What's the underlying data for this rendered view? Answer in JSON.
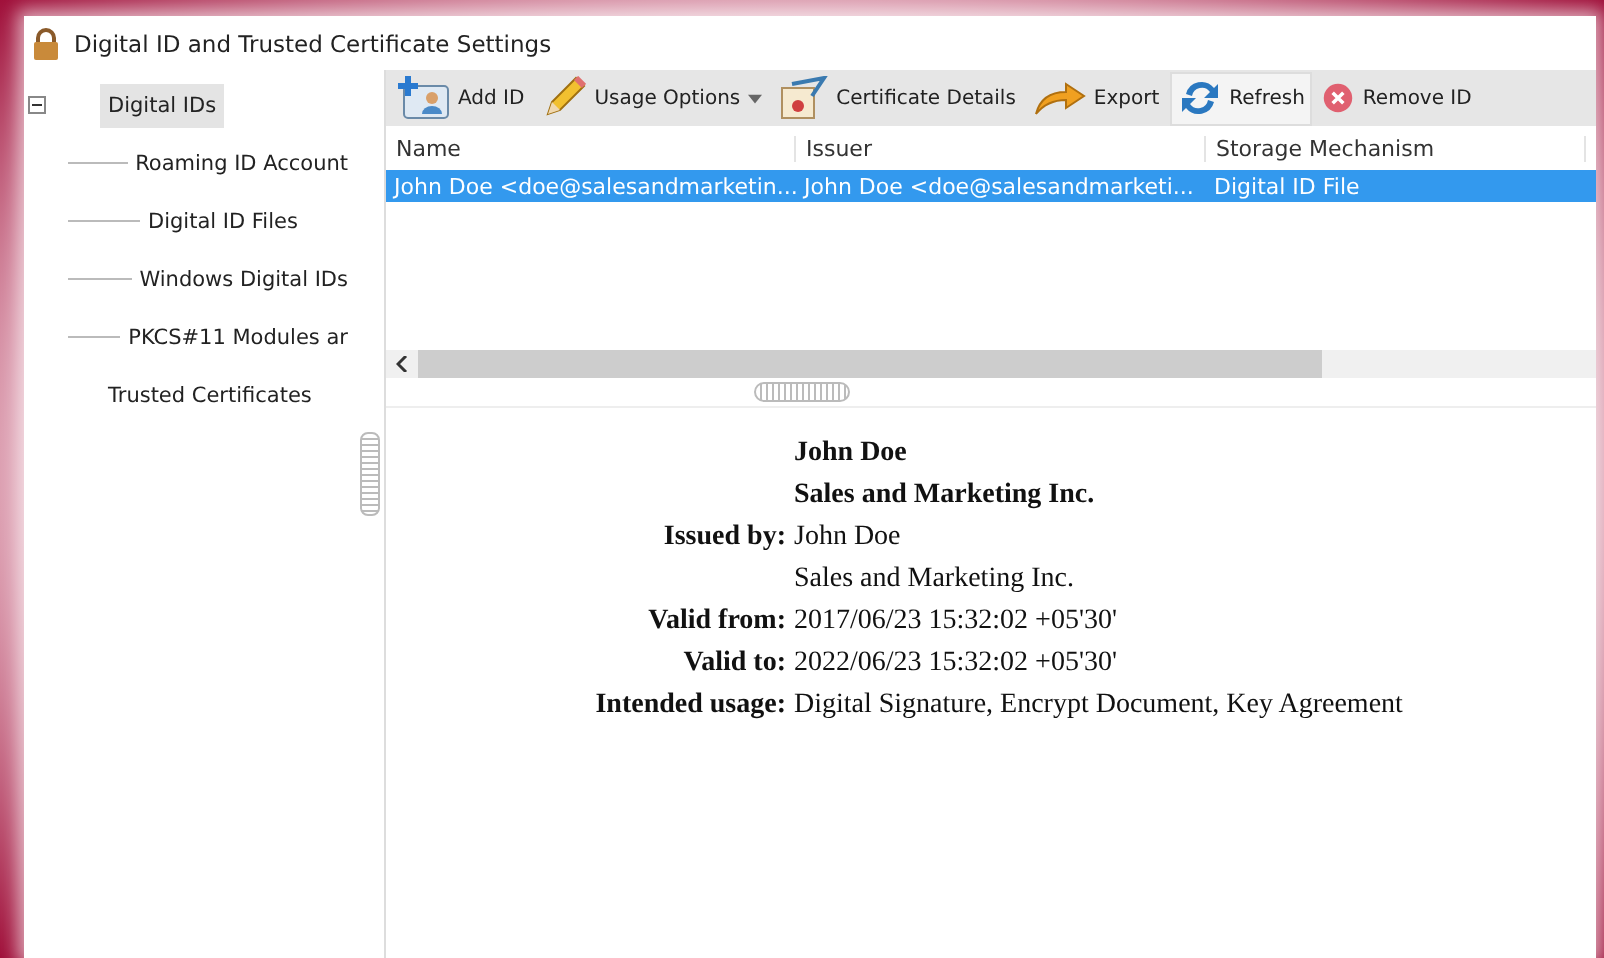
{
  "window": {
    "title": "Digital ID and Trusted Certificate Settings"
  },
  "sidebar": {
    "items": [
      {
        "label": "Digital IDs",
        "selected": true,
        "expanded": true,
        "children": [
          {
            "label": "Roaming ID Account",
            "selected": false
          },
          {
            "label": "Digital ID Files",
            "selected": false
          },
          {
            "label": "Windows Digital IDs",
            "selected": false
          },
          {
            "label": "PKCS#11 Modules ar",
            "selected": false
          }
        ]
      },
      {
        "label": "Trusted Certificates",
        "selected": false
      }
    ]
  },
  "toolbar": [
    {
      "kind": "add",
      "label": "Add ID",
      "highlighted": false
    },
    {
      "kind": "usage",
      "label": "Usage Options",
      "highlighted": false
    },
    {
      "kind": "details",
      "label": "Certificate Details",
      "highlighted": false
    },
    {
      "kind": "export",
      "label": "Export",
      "highlighted": false
    },
    {
      "kind": "refresh",
      "label": "Refresh",
      "highlighted": true
    },
    {
      "kind": "remove",
      "label": "Remove ID",
      "highlighted": false
    }
  ],
  "table": {
    "columns": [
      "Name",
      "Issuer",
      "Storage Mechanism"
    ],
    "rows": [
      {
        "cells": [
          "John Doe <doe@salesandmarketin...",
          "John Doe <doe@salesandmarketi...",
          "Digital ID File"
        ],
        "selected": true
      }
    ]
  },
  "details": [
    {
      "value": "John Doe",
      "bold": true
    },
    {
      "value": "Sales and Marketing Inc.",
      "bold": true
    },
    {
      "label": "Issued by:",
      "value": "John Doe",
      "bold": false
    },
    {
      "value": "Sales and Marketing Inc.",
      "bold": false
    },
    {
      "label": "Valid from:",
      "value": "2017/06/23 15:32:02 +05'30'",
      "bold": false
    },
    {
      "label": "Valid to:",
      "value": "2022/06/23 15:32:02 +05'30'",
      "bold": false
    },
    {
      "label": "Intended usage:",
      "value": "Digital Signature, Encrypt Document, Key Agreement",
      "bold": false
    }
  ]
}
